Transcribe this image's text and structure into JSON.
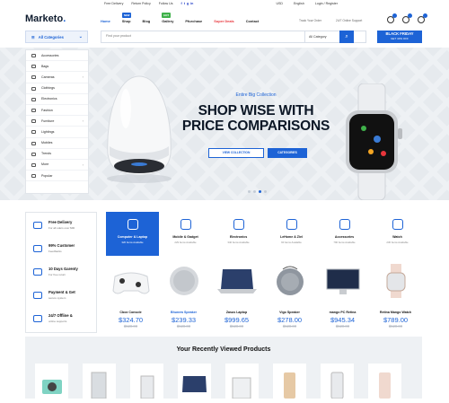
{
  "topbar": {
    "links": [
      "Free Delivery",
      "Return Policy",
      "Follow Us"
    ],
    "social": [
      "f",
      "t",
      "g",
      "in"
    ],
    "currency": "USD",
    "language": "English",
    "account": "Login / Register"
  },
  "header": {
    "logo_text": "Marketo",
    "logo_dot": ".",
    "nav": [
      {
        "label": "Home",
        "badge": ""
      },
      {
        "label": "Shop",
        "badge": "NEW"
      },
      {
        "label": "Blog",
        "badge": ""
      },
      {
        "label": "Gallery",
        "badge": "HOT"
      },
      {
        "label": "Pfurchase",
        "badge": ""
      },
      {
        "label": "Super Deals",
        "badge": ""
      },
      {
        "label": "Contact",
        "badge": ""
      }
    ],
    "track_order": "Track Your Order",
    "support": "24/7 Online Support"
  },
  "search": {
    "all_categories": "All Categories",
    "placeholder": "Find your product",
    "category_select": "All Category",
    "black_friday": "BLACK FRIDAY",
    "black_friday_sub": "GET 40% OFF"
  },
  "sidebar": {
    "items": [
      "Accessories",
      "Bags",
      "Cameras",
      "Clothings",
      "Electronics",
      "Fashion",
      "Furniture",
      "Lightings",
      "Mobiles",
      "Trends",
      "More",
      "Popular"
    ]
  },
  "hero": {
    "subtitle": "Entire Big Collection",
    "title_line1": "SHOP WISE WITH",
    "title_line2": "PRICE COMPARISONS",
    "btn_view": "VIEW COLLECTION",
    "btn_category": "CATEGORIES"
  },
  "features": [
    {
      "title": "Free Delivery",
      "sub": "For all oders over $90"
    },
    {
      "title": "99% Customer",
      "sub": "Feedbacks"
    },
    {
      "title": "10 Days Garenty",
      "sub": "For free return"
    },
    {
      "title": "Payment & Get",
      "sub": "secure system"
    },
    {
      "title": "24/7 Offline &",
      "sub": "online supports"
    }
  ],
  "categories": [
    {
      "name": "Computer & Laptop",
      "count": "320 Items Available"
    },
    {
      "name": "Mobile & Gadget",
      "count": "229 Items Available"
    },
    {
      "name": "Electronics",
      "count": "340 Items Available"
    },
    {
      "name": "LeHome & Ziel",
      "count": "90 Items Available"
    },
    {
      "name": "Accessories",
      "count": "790 Items Available"
    },
    {
      "name": "Watch",
      "count": "230 Items Available"
    }
  ],
  "products": [
    {
      "name": "Cbox Console",
      "price": "$324.70",
      "old": "$520.00"
    },
    {
      "name": "Bhunew Speaker",
      "price": "$239.33",
      "old": "$520.00"
    },
    {
      "name": "Zasus Laptop",
      "price": "$999.65",
      "old": "$520.00"
    },
    {
      "name": "Vigo Speaker",
      "price": "$278.00",
      "old": "$520.00"
    },
    {
      "name": "mango PC Retina",
      "price": "$945.34",
      "old": "$520.00"
    },
    {
      "name": "Retina Mango Watch",
      "price": "$789.00",
      "old": "$520.00"
    }
  ],
  "recent": {
    "title": "Your Recently Viewed Products"
  }
}
